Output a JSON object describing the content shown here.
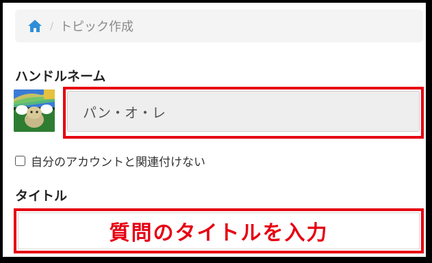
{
  "breadcrumb": {
    "home_icon": "home-icon",
    "separator": "/",
    "current": "トピック作成"
  },
  "form": {
    "handle_label": "ハンドルネーム",
    "handle_value": "パン・オ・レ",
    "checkbox_label": "自分のアカウントと関連付けない",
    "checkbox_checked": false,
    "title_label": "タイトル",
    "title_placeholder": "質問のタイトルを入力"
  },
  "colors": {
    "accent": "#e60012",
    "home": "#2f8fd8"
  }
}
